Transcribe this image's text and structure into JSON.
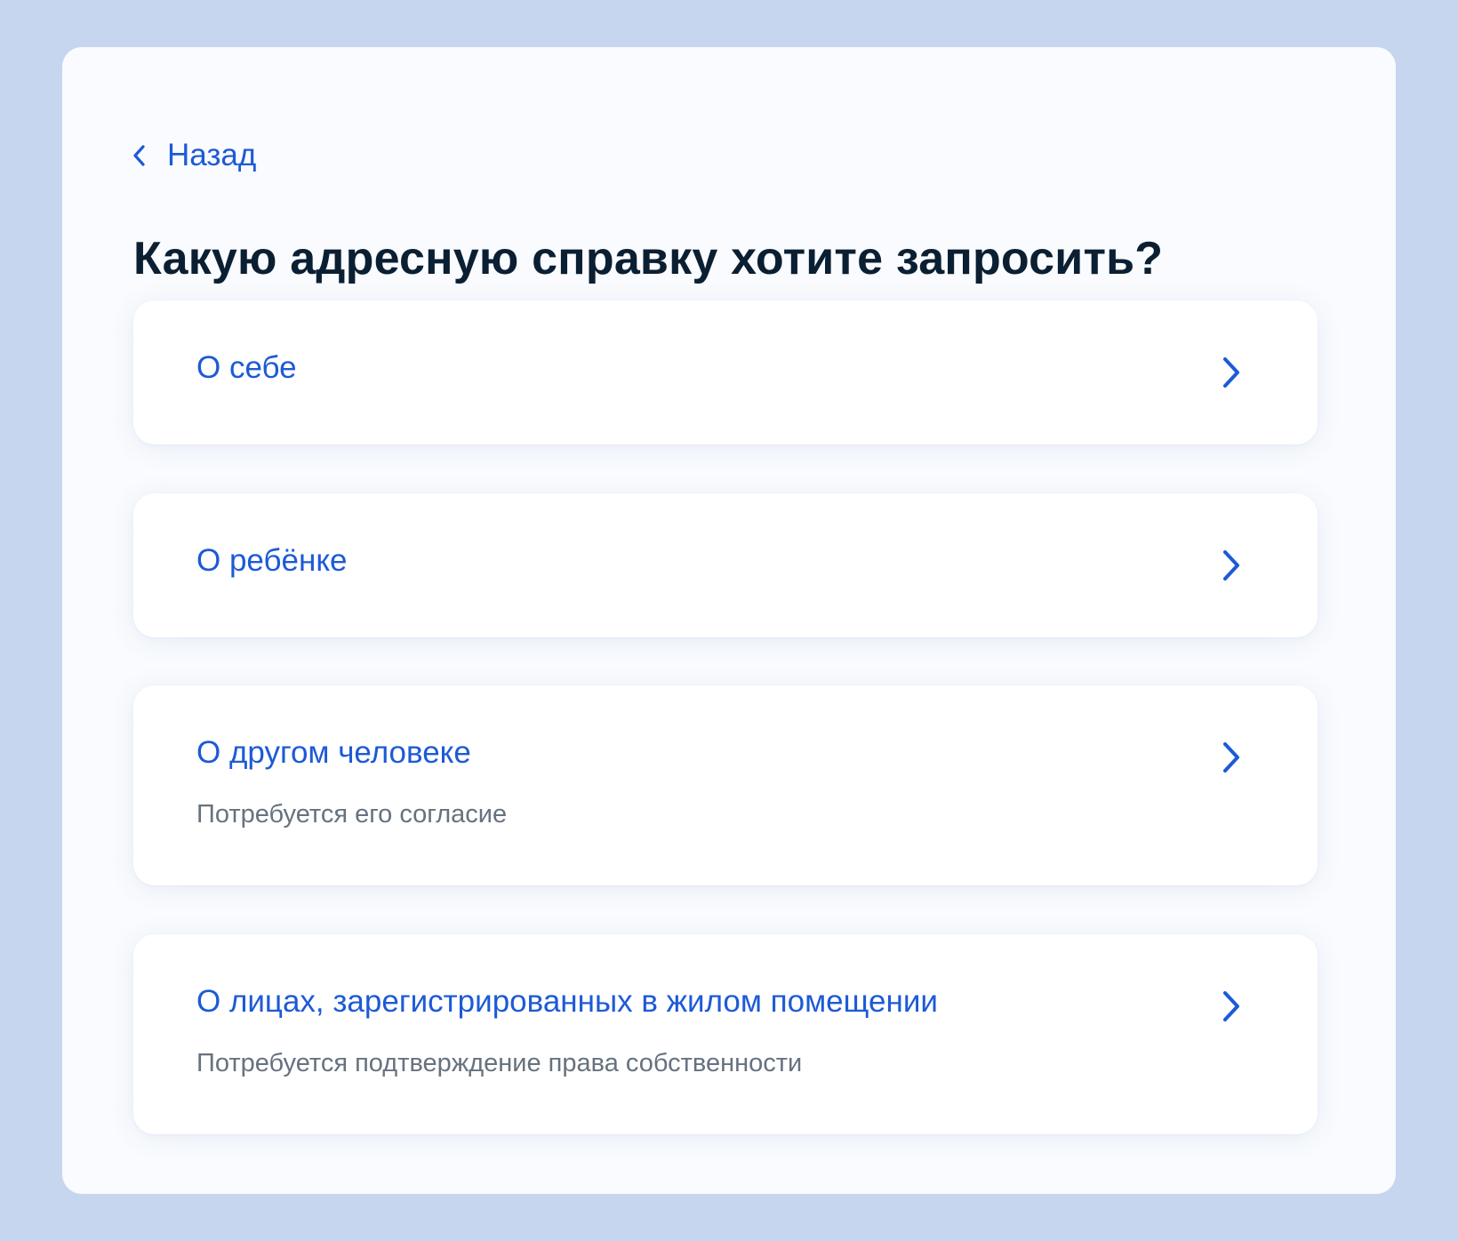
{
  "back": {
    "label": "Назад",
    "icon": "chevron-left-icon"
  },
  "page": {
    "title": "Какую адресную справку хотите запросить?"
  },
  "options": [
    {
      "label": "О себе",
      "hint": ""
    },
    {
      "label": "О ребёнке",
      "hint": ""
    },
    {
      "label": "О другом человеке",
      "hint": "Потребуется его согласие"
    },
    {
      "label": "О лицах, зарегистрированных в жилом помещении",
      "hint": "Потребуется подтверждение права собственности"
    }
  ],
  "colors": {
    "background": "#c6d6ee",
    "card": "#f9fbfe",
    "accent": "#1d5ad6",
    "title": "#0b1f33",
    "hint": "#66727f"
  }
}
